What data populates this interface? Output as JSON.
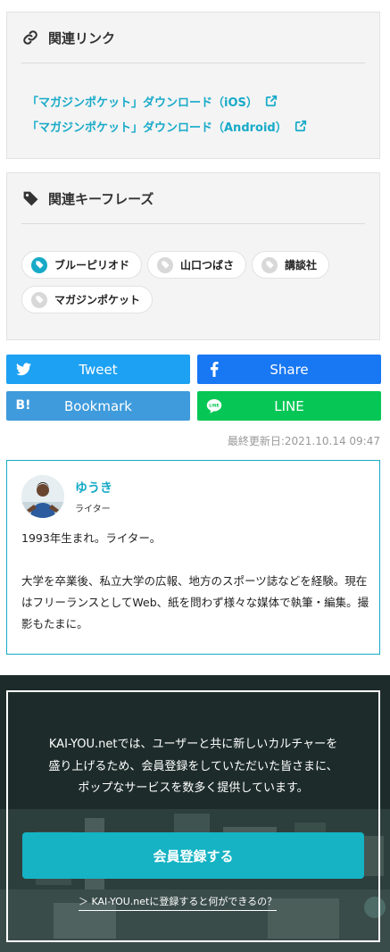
{
  "related_links": {
    "title": "関連リンク",
    "icon": "link-icon",
    "items": [
      {
        "label": "「マガジンポケット」ダウンロード（iOS）",
        "icon": "external-link-icon"
      },
      {
        "label": "「マガジンポケット」ダウンロード（Android）",
        "icon": "external-link-icon"
      }
    ]
  },
  "related_keyphrases": {
    "title": "関連キーフレーズ",
    "icon": "tag-icon",
    "tags": [
      {
        "label": "ブルーピリオド",
        "active": true
      },
      {
        "label": "山口つばさ",
        "active": false
      },
      {
        "label": "講談社",
        "active": false
      },
      {
        "label": "マガジンポケット",
        "active": false
      }
    ]
  },
  "share": {
    "tweet": {
      "label": "Tweet",
      "color": "#1da1f2",
      "icon": "twitter-icon"
    },
    "facebook": {
      "label": "Share",
      "color": "#1877f2",
      "icon": "facebook-icon"
    },
    "bookmark": {
      "label": "Bookmark",
      "color": "#3f9bdc",
      "icon": "hatena-bookmark-icon",
      "icon_text": "B!"
    },
    "line": {
      "label": "LINE",
      "color": "#06c755",
      "icon": "line-icon"
    }
  },
  "last_updated": "最終更新日:2021.10.14 09:47",
  "author": {
    "name": "ゆうき",
    "role": "ライター",
    "bio": [
      "1993年生まれ。ライター。",
      "大学を卒業後、私立大学の広報、地方のスポーツ誌などを経験。現在はフリーランスとしてWeb、紙を問わず様々な媒体で執筆・編集。撮影もたまに。"
    ]
  },
  "promo": {
    "message_lines": [
      "KAI-YOU.netでは、ユーザーと共に新しいカルチャーを",
      "盛り上げるため、会員登録をしていただいた皆さまに、",
      "ポップなサービスを数多く提供しています。"
    ],
    "cta_label": "会員登録する",
    "more_link": "＞ KAI-YOU.netに登録すると何ができるの？",
    "accent_color": "#15b3c4"
  }
}
